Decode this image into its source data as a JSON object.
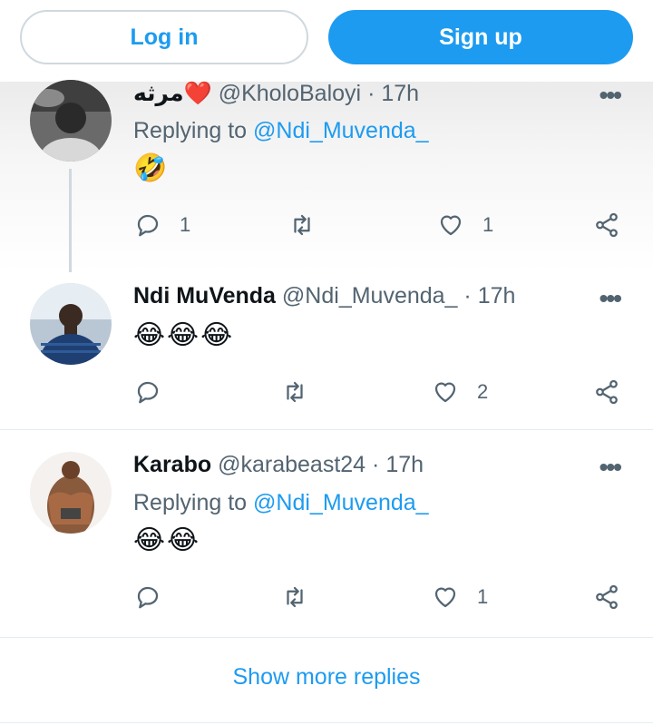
{
  "top_bar": {
    "login_label": "Log in",
    "signup_label": "Sign up"
  },
  "tweets": [
    {
      "name": "مرثه",
      "name_emoji": "❤️",
      "handle": "@KholoBaloyi",
      "separator": "·",
      "time": "17h",
      "replying_label": "Replying to",
      "replying_to": "@Ndi_Muvenda_",
      "body": "🤣",
      "reply_count": "1",
      "retweet_count": "",
      "like_count": "1"
    },
    {
      "name": "Ndi MuVenda",
      "handle": "@Ndi_Muvenda_",
      "separator": "·",
      "time": "17h",
      "body": "😂😂😂",
      "reply_count": "",
      "retweet_count": "",
      "like_count": "2"
    },
    {
      "name": "Karabo",
      "handle": "@karabeast24",
      "separator": "·",
      "time": "17h",
      "replying_label": "Replying to",
      "replying_to": "@Ndi_Muvenda_",
      "body": "😂😂",
      "reply_count": "",
      "retweet_count": "",
      "like_count": "1"
    }
  ],
  "show_more_label": "Show more replies",
  "colors": {
    "accent": "#1d9bf0",
    "secondary_text": "#536471",
    "border": "#cfd9de"
  }
}
